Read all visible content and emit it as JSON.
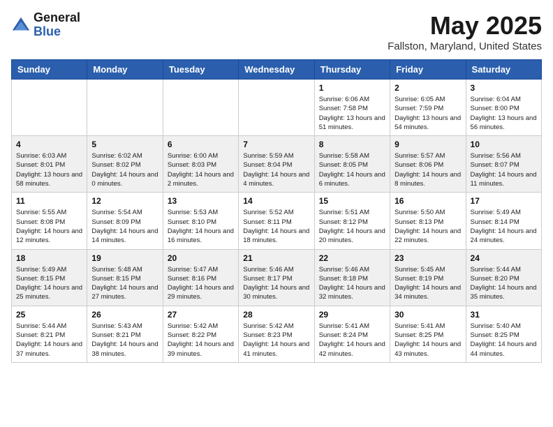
{
  "header": {
    "logo_general": "General",
    "logo_blue": "Blue",
    "month_year": "May 2025",
    "location": "Fallston, Maryland, United States"
  },
  "days_of_week": [
    "Sunday",
    "Monday",
    "Tuesday",
    "Wednesday",
    "Thursday",
    "Friday",
    "Saturday"
  ],
  "weeks": [
    [
      {
        "day": "",
        "sunrise": "",
        "sunset": "",
        "daylight": ""
      },
      {
        "day": "",
        "sunrise": "",
        "sunset": "",
        "daylight": ""
      },
      {
        "day": "",
        "sunrise": "",
        "sunset": "",
        "daylight": ""
      },
      {
        "day": "",
        "sunrise": "",
        "sunset": "",
        "daylight": ""
      },
      {
        "day": "1",
        "sunrise": "Sunrise: 6:06 AM",
        "sunset": "Sunset: 7:58 PM",
        "daylight": "Daylight: 13 hours and 51 minutes."
      },
      {
        "day": "2",
        "sunrise": "Sunrise: 6:05 AM",
        "sunset": "Sunset: 7:59 PM",
        "daylight": "Daylight: 13 hours and 54 minutes."
      },
      {
        "day": "3",
        "sunrise": "Sunrise: 6:04 AM",
        "sunset": "Sunset: 8:00 PM",
        "daylight": "Daylight: 13 hours and 56 minutes."
      }
    ],
    [
      {
        "day": "4",
        "sunrise": "Sunrise: 6:03 AM",
        "sunset": "Sunset: 8:01 PM",
        "daylight": "Daylight: 13 hours and 58 minutes."
      },
      {
        "day": "5",
        "sunrise": "Sunrise: 6:02 AM",
        "sunset": "Sunset: 8:02 PM",
        "daylight": "Daylight: 14 hours and 0 minutes."
      },
      {
        "day": "6",
        "sunrise": "Sunrise: 6:00 AM",
        "sunset": "Sunset: 8:03 PM",
        "daylight": "Daylight: 14 hours and 2 minutes."
      },
      {
        "day": "7",
        "sunrise": "Sunrise: 5:59 AM",
        "sunset": "Sunset: 8:04 PM",
        "daylight": "Daylight: 14 hours and 4 minutes."
      },
      {
        "day": "8",
        "sunrise": "Sunrise: 5:58 AM",
        "sunset": "Sunset: 8:05 PM",
        "daylight": "Daylight: 14 hours and 6 minutes."
      },
      {
        "day": "9",
        "sunrise": "Sunrise: 5:57 AM",
        "sunset": "Sunset: 8:06 PM",
        "daylight": "Daylight: 14 hours and 8 minutes."
      },
      {
        "day": "10",
        "sunrise": "Sunrise: 5:56 AM",
        "sunset": "Sunset: 8:07 PM",
        "daylight": "Daylight: 14 hours and 11 minutes."
      }
    ],
    [
      {
        "day": "11",
        "sunrise": "Sunrise: 5:55 AM",
        "sunset": "Sunset: 8:08 PM",
        "daylight": "Daylight: 14 hours and 12 minutes."
      },
      {
        "day": "12",
        "sunrise": "Sunrise: 5:54 AM",
        "sunset": "Sunset: 8:09 PM",
        "daylight": "Daylight: 14 hours and 14 minutes."
      },
      {
        "day": "13",
        "sunrise": "Sunrise: 5:53 AM",
        "sunset": "Sunset: 8:10 PM",
        "daylight": "Daylight: 14 hours and 16 minutes."
      },
      {
        "day": "14",
        "sunrise": "Sunrise: 5:52 AM",
        "sunset": "Sunset: 8:11 PM",
        "daylight": "Daylight: 14 hours and 18 minutes."
      },
      {
        "day": "15",
        "sunrise": "Sunrise: 5:51 AM",
        "sunset": "Sunset: 8:12 PM",
        "daylight": "Daylight: 14 hours and 20 minutes."
      },
      {
        "day": "16",
        "sunrise": "Sunrise: 5:50 AM",
        "sunset": "Sunset: 8:13 PM",
        "daylight": "Daylight: 14 hours and 22 minutes."
      },
      {
        "day": "17",
        "sunrise": "Sunrise: 5:49 AM",
        "sunset": "Sunset: 8:14 PM",
        "daylight": "Daylight: 14 hours and 24 minutes."
      }
    ],
    [
      {
        "day": "18",
        "sunrise": "Sunrise: 5:49 AM",
        "sunset": "Sunset: 8:15 PM",
        "daylight": "Daylight: 14 hours and 25 minutes."
      },
      {
        "day": "19",
        "sunrise": "Sunrise: 5:48 AM",
        "sunset": "Sunset: 8:15 PM",
        "daylight": "Daylight: 14 hours and 27 minutes."
      },
      {
        "day": "20",
        "sunrise": "Sunrise: 5:47 AM",
        "sunset": "Sunset: 8:16 PM",
        "daylight": "Daylight: 14 hours and 29 minutes."
      },
      {
        "day": "21",
        "sunrise": "Sunrise: 5:46 AM",
        "sunset": "Sunset: 8:17 PM",
        "daylight": "Daylight: 14 hours and 30 minutes."
      },
      {
        "day": "22",
        "sunrise": "Sunrise: 5:46 AM",
        "sunset": "Sunset: 8:18 PM",
        "daylight": "Daylight: 14 hours and 32 minutes."
      },
      {
        "day": "23",
        "sunrise": "Sunrise: 5:45 AM",
        "sunset": "Sunset: 8:19 PM",
        "daylight": "Daylight: 14 hours and 34 minutes."
      },
      {
        "day": "24",
        "sunrise": "Sunrise: 5:44 AM",
        "sunset": "Sunset: 8:20 PM",
        "daylight": "Daylight: 14 hours and 35 minutes."
      }
    ],
    [
      {
        "day": "25",
        "sunrise": "Sunrise: 5:44 AM",
        "sunset": "Sunset: 8:21 PM",
        "daylight": "Daylight: 14 hours and 37 minutes."
      },
      {
        "day": "26",
        "sunrise": "Sunrise: 5:43 AM",
        "sunset": "Sunset: 8:21 PM",
        "daylight": "Daylight: 14 hours and 38 minutes."
      },
      {
        "day": "27",
        "sunrise": "Sunrise: 5:42 AM",
        "sunset": "Sunset: 8:22 PM",
        "daylight": "Daylight: 14 hours and 39 minutes."
      },
      {
        "day": "28",
        "sunrise": "Sunrise: 5:42 AM",
        "sunset": "Sunset: 8:23 PM",
        "daylight": "Daylight: 14 hours and 41 minutes."
      },
      {
        "day": "29",
        "sunrise": "Sunrise: 5:41 AM",
        "sunset": "Sunset: 8:24 PM",
        "daylight": "Daylight: 14 hours and 42 minutes."
      },
      {
        "day": "30",
        "sunrise": "Sunrise: 5:41 AM",
        "sunset": "Sunset: 8:25 PM",
        "daylight": "Daylight: 14 hours and 43 minutes."
      },
      {
        "day": "31",
        "sunrise": "Sunrise: 5:40 AM",
        "sunset": "Sunset: 8:25 PM",
        "daylight": "Daylight: 14 hours and 44 minutes."
      }
    ]
  ]
}
